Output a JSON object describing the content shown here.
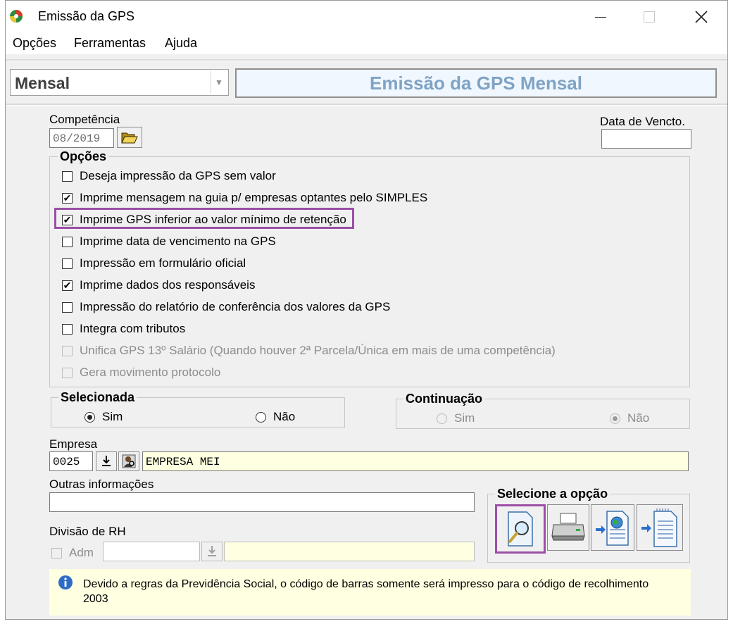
{
  "window": {
    "title": "Emissão da GPS"
  },
  "menu": [
    "Opções",
    "Ferramentas",
    "Ajuda"
  ],
  "period_select": {
    "value": "Mensal"
  },
  "banner": {
    "title": "Emissão da GPS Mensal"
  },
  "competencia": {
    "label": "Competência",
    "value": "08/2019"
  },
  "vencimento": {
    "label": "Data de Vencto.",
    "value": ""
  },
  "opcoes": {
    "title": "Opções",
    "items": [
      {
        "label": "Deseja impressão da GPS sem valor",
        "checked": false,
        "enabled": true
      },
      {
        "label": "Imprime mensagem na guia p/ empresas optantes pelo SIMPLES",
        "checked": true,
        "enabled": true
      },
      {
        "label": "Imprime GPS inferior ao valor mínimo de retenção",
        "checked": true,
        "enabled": true,
        "highlighted": true
      },
      {
        "label": "Imprime data de vencimento na GPS",
        "checked": false,
        "enabled": true
      },
      {
        "label": "Impressão em formulário oficial",
        "checked": false,
        "enabled": true
      },
      {
        "label": "Imprime dados dos responsáveis",
        "checked": true,
        "enabled": true
      },
      {
        "label": "Impressão do relatório de conferência dos valores da GPS",
        "checked": false,
        "enabled": true
      },
      {
        "label": "Integra com tributos",
        "checked": false,
        "enabled": true
      },
      {
        "label": "Unifica GPS 13º Salário (Quando houver 2ª Parcela/Única em mais de uma competência)",
        "checked": false,
        "enabled": false
      },
      {
        "label": "Gera movimento protocolo",
        "checked": false,
        "enabled": false
      }
    ]
  },
  "selecionada": {
    "title": "Selecionada",
    "sim": "Sim",
    "nao": "Não",
    "selected": "sim"
  },
  "continuacao": {
    "title": "Continuação",
    "sim": "Sim",
    "nao": "Não",
    "selected": "nao"
  },
  "empresa": {
    "label": "Empresa",
    "code": "0025",
    "name": "EMPRESA MEI"
  },
  "outras": {
    "label": "Outras informações",
    "value": ""
  },
  "divisao": {
    "label": "Divisão de RH",
    "adm_label": "Adm",
    "adm_checked": false,
    "code": "",
    "name": ""
  },
  "selecione": {
    "title": "Selecione a opção"
  },
  "info": {
    "text": "Devido a regras da Previdência Social, o código de barras somente será impresso para o código de recolhimento 2003"
  }
}
